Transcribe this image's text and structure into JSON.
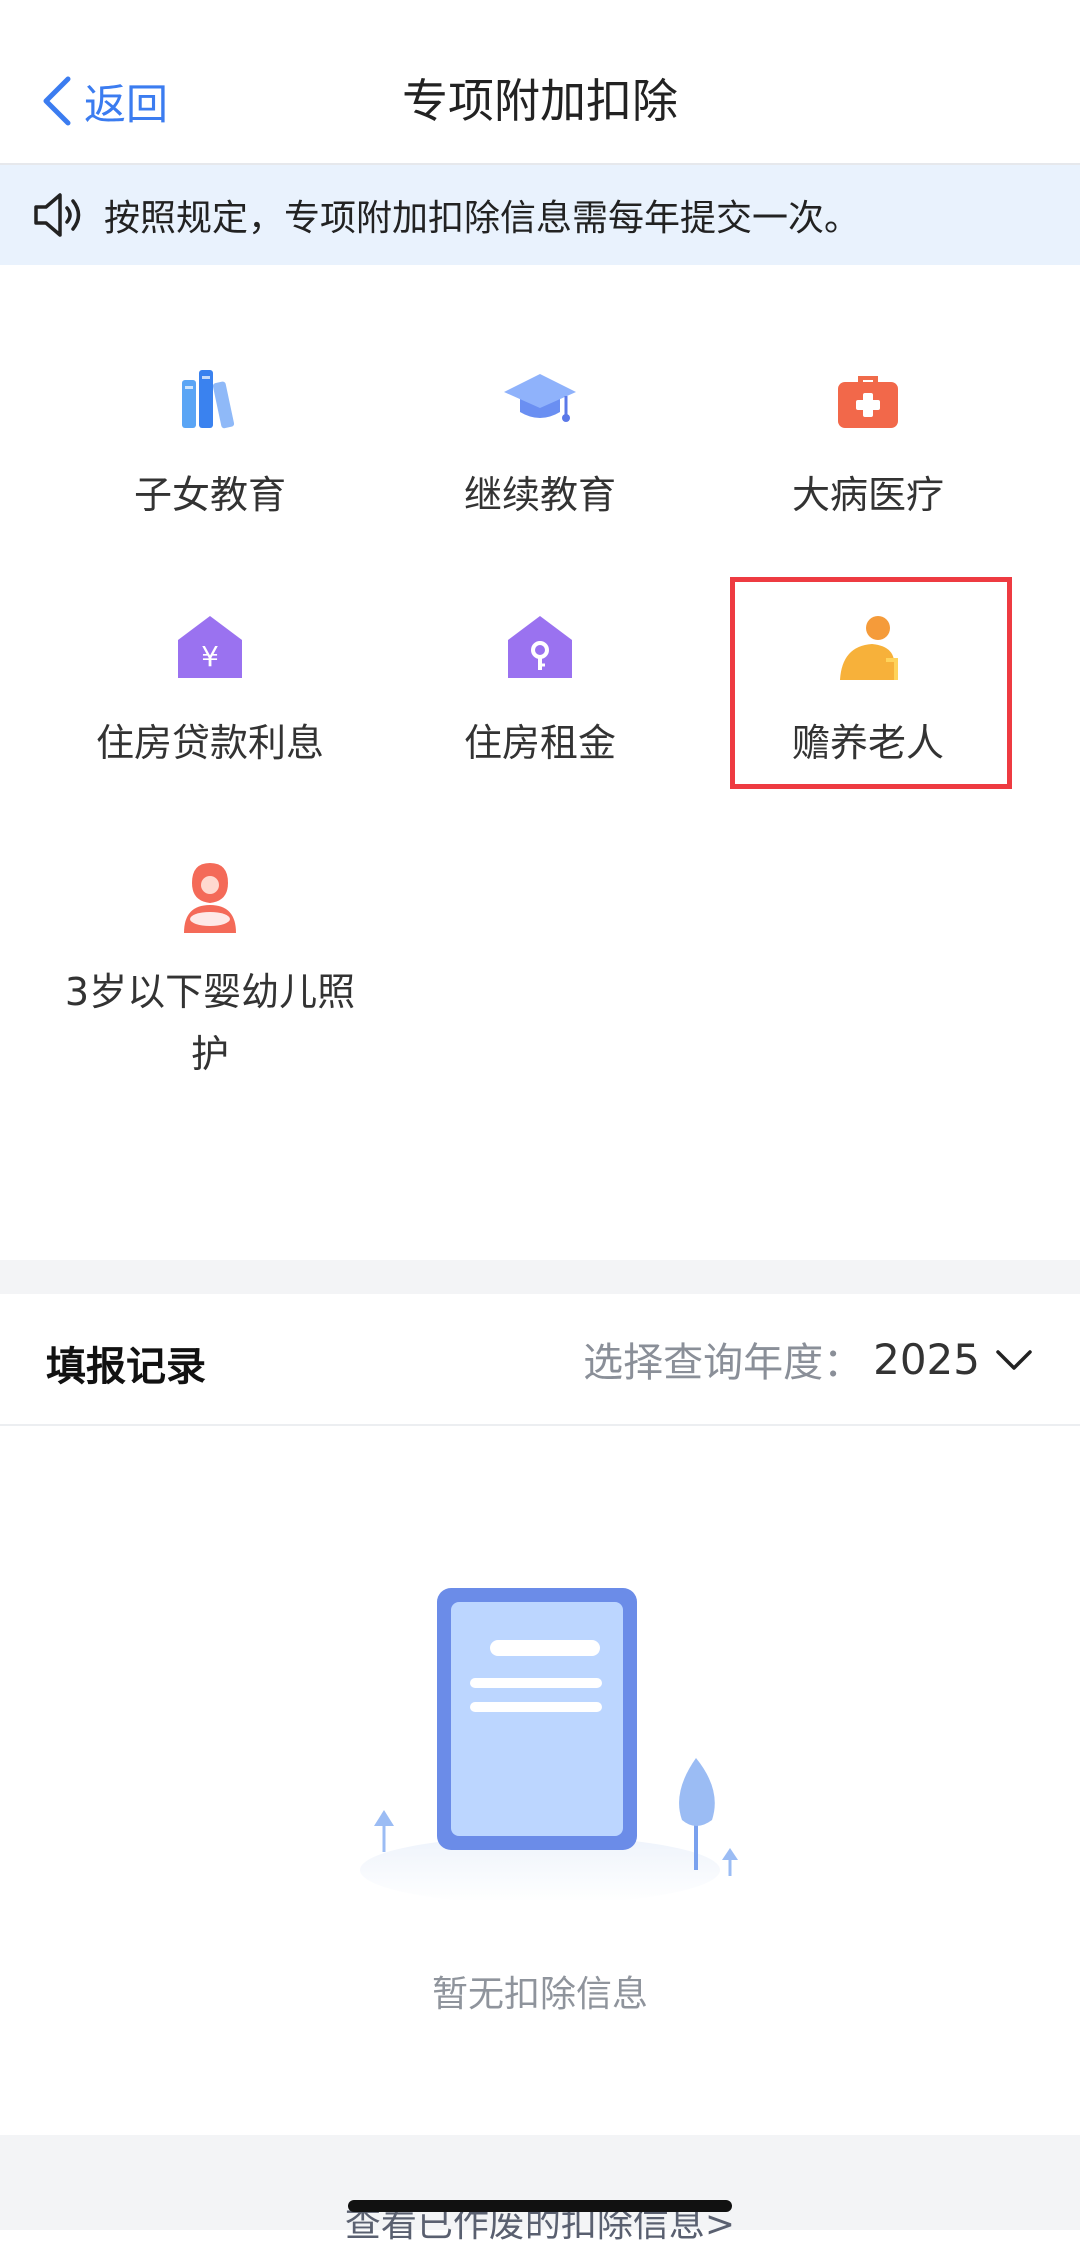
{
  "header": {
    "back_label": "返回",
    "title": "专项附加扣除"
  },
  "notice": {
    "text": "按照规定，专项附加扣除信息需每年提交一次。"
  },
  "deductions": {
    "children_education": "子女教育",
    "continuing_education": "继续教育",
    "serious_illness": "大病医疗",
    "housing_loan_interest": "住房贷款利息",
    "housing_rent": "住房租金",
    "elderly_support": "赡养老人",
    "infant_care_line1": "3岁以下婴幼儿照",
    "infant_care_line2": "护"
  },
  "records": {
    "title": "填报记录",
    "year_label": "选择查询年度：",
    "year_value": "2025",
    "empty_text": "暂无扣除信息"
  },
  "footer": {
    "link_text": "查看已作废的扣除信息>"
  },
  "colors": {
    "accent": "#3b7cf0",
    "notice_bg": "#e9f2fd",
    "highlight_border": "#ee3b41"
  }
}
